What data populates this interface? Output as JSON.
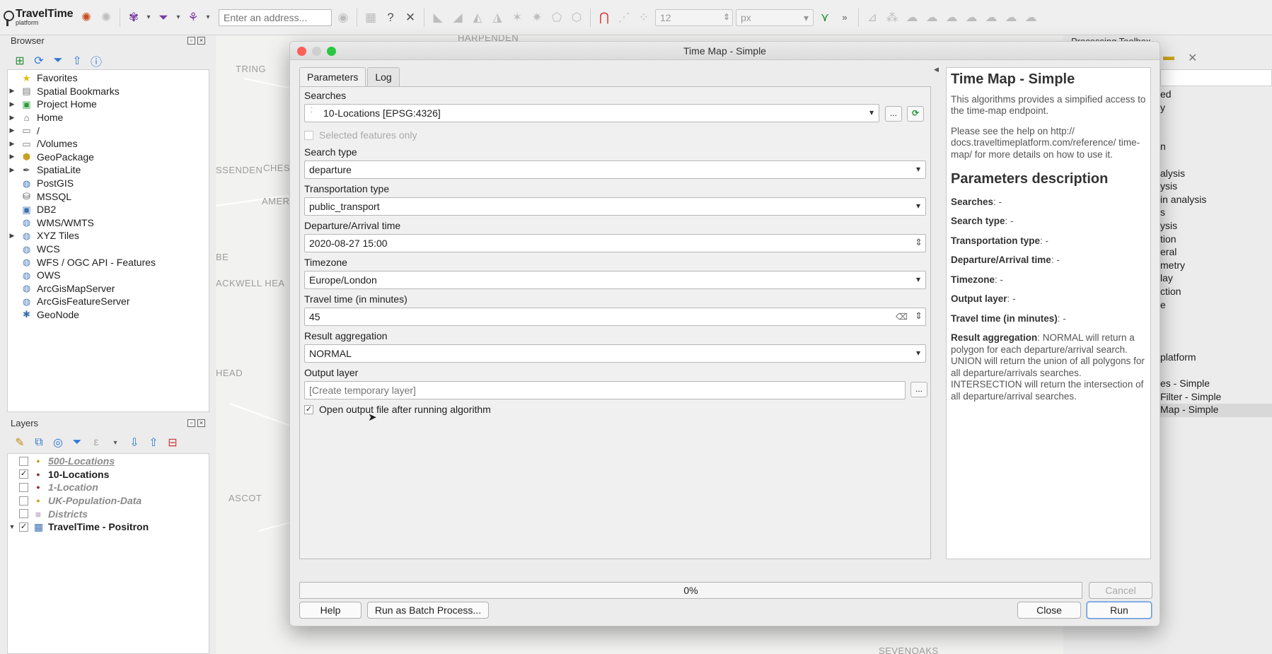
{
  "app": {
    "logo_title": "TravelTime",
    "logo_subtitle": "platform",
    "address_placeholder": "Enter an address...",
    "spin_value": "12",
    "unit_value": "px"
  },
  "browser": {
    "title": "Browser",
    "items": [
      {
        "label": "Favorites",
        "icon": "star-icon",
        "expandable": false
      },
      {
        "label": "Spatial Bookmarks",
        "icon": "bookmark-icon",
        "expandable": true
      },
      {
        "label": "Project Home",
        "icon": "project-folder-icon",
        "expandable": true
      },
      {
        "label": "Home",
        "icon": "home-folder-icon",
        "expandable": true
      },
      {
        "label": "/",
        "icon": "folder-icon",
        "expandable": true
      },
      {
        "label": "/Volumes",
        "icon": "folder-icon",
        "expandable": true
      },
      {
        "label": "GeoPackage",
        "icon": "geopackage-icon",
        "expandable": true
      },
      {
        "label": "SpatiaLite",
        "icon": "spatialite-icon",
        "expandable": true
      },
      {
        "label": "PostGIS",
        "icon": "postgis-icon",
        "expandable": false
      },
      {
        "label": "MSSQL",
        "icon": "mssql-icon",
        "expandable": false
      },
      {
        "label": "DB2",
        "icon": "db2-icon",
        "expandable": false
      },
      {
        "label": "WMS/WMTS",
        "icon": "globe-icon",
        "expandable": false
      },
      {
        "label": "XYZ Tiles",
        "icon": "globe-icon",
        "expandable": true
      },
      {
        "label": "WCS",
        "icon": "globe-icon",
        "expandable": false
      },
      {
        "label": "WFS / OGC API - Features",
        "icon": "globe-icon",
        "expandable": false
      },
      {
        "label": "OWS",
        "icon": "globe-icon",
        "expandable": false
      },
      {
        "label": "ArcGisMapServer",
        "icon": "globe-icon",
        "expandable": false
      },
      {
        "label": "ArcGisFeatureServer",
        "icon": "globe-icon",
        "expandable": false
      },
      {
        "label": "GeoNode",
        "icon": "geonode-icon",
        "expandable": false
      }
    ]
  },
  "layers": {
    "title": "Layers",
    "items": [
      {
        "label": "500-Locations",
        "checked": false,
        "style": "italic-underline"
      },
      {
        "label": "10-Locations",
        "checked": true,
        "style": "bold"
      },
      {
        "label": "1-Location",
        "checked": false,
        "style": "italic"
      },
      {
        "label": "UK-Population-Data",
        "checked": false,
        "style": "italic"
      },
      {
        "label": "Districts",
        "checked": false,
        "style": "italic"
      },
      {
        "label": "TravelTime - Positron",
        "checked": true,
        "style": "bold"
      }
    ]
  },
  "map_labels": [
    "HARPENDEN",
    "TRING",
    "SSENDEN",
    "CHES",
    "AMER",
    "BE",
    "ACKWELL HEA",
    "HEAD",
    "ASCOT",
    "SEVENOAKS"
  ],
  "processing": {
    "title": "Processing Toolbox",
    "items": [
      "ed",
      "y",
      "",
      "",
      "n",
      "",
      "alysis",
      "ysis",
      "in analysis",
      "s",
      "ysis",
      "tion",
      "eral",
      "metry",
      "lay",
      "ction",
      "e",
      "",
      "",
      "",
      "platform",
      "",
      "es - Simple",
      "Filter - Simple",
      "Map - Simple"
    ]
  },
  "dialog": {
    "title": "Time Map - Simple",
    "tabs": [
      "Parameters",
      "Log"
    ],
    "searches_label": "Searches",
    "searches_value": "10-Locations [EPSG:4326]",
    "selected_only": "Selected features only",
    "search_type_label": "Search type",
    "search_type_value": "departure",
    "transport_label": "Transportation type",
    "transport_value": "public_transport",
    "time_label": "Departure/Arrival time",
    "time_value": "2020-08-27 15:00",
    "timezone_label": "Timezone",
    "timezone_value": "Europe/London",
    "travel_label": "Travel time (in minutes)",
    "travel_value": "45",
    "aggregation_label": "Result aggregation",
    "aggregation_value": "NORMAL",
    "output_label": "Output layer",
    "output_placeholder": "[Create temporary layer]",
    "open_output": "Open output file after running algorithm",
    "ellipsis": "...",
    "progress_label": "0%",
    "progress": 0,
    "buttons": {
      "cancel": "Cancel",
      "help": "Help",
      "batch": "Run as Batch Process...",
      "close": "Close",
      "run": "Run"
    }
  },
  "help": {
    "title": "Time Map - Simple",
    "intro": "This algorithms provides a simpified access to the time-map endpoint.",
    "see_help": "Please see the help on http:// docs.traveltimeplatform.com/reference/ time-map/ for more details on how to use it.",
    "params_title": "Parameters description",
    "params": [
      {
        "name": "Searches",
        "desc": ": -"
      },
      {
        "name": "Search type",
        "desc": ": -"
      },
      {
        "name": "Transportation type",
        "desc": ": -"
      },
      {
        "name": "Departure/Arrival time",
        "desc": ": -"
      },
      {
        "name": "Timezone",
        "desc": ": -"
      },
      {
        "name": "Output layer",
        "desc": ": -"
      },
      {
        "name": "Travel time (in minutes)",
        "desc": ": -"
      },
      {
        "name": "Result aggregation",
        "desc": ": NORMAL will return a polygon for each departure/arrival search. UNION will return the union of all polygons for all departure/arrivals searches. INTERSECTION will return the intersection of all departure/arrival searches."
      }
    ]
  },
  "colors": {
    "accent": "#2f79d6",
    "close_dot": "#ff5f57",
    "min_dot": "#d0d0d0",
    "max_dot": "#28c840"
  }
}
